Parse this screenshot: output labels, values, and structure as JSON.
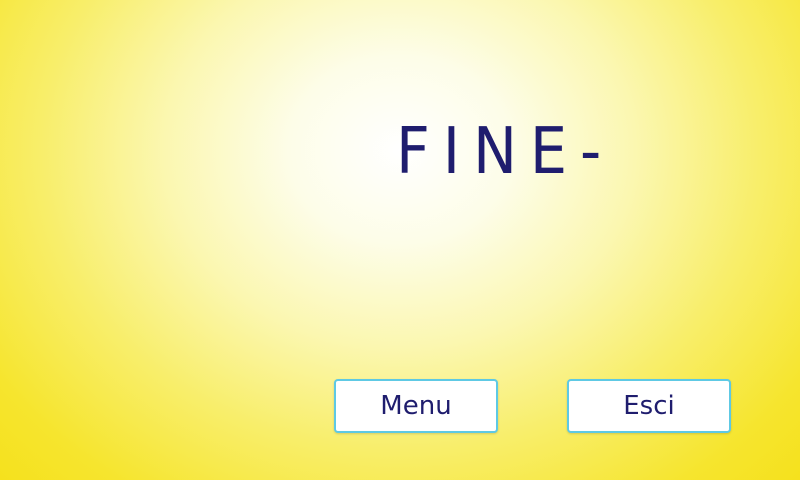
{
  "screen": {
    "headline": "FINE-"
  },
  "buttons": {
    "menu_label": "Menu",
    "exit_label": "Esci"
  },
  "colors": {
    "background_center": "#ffffff",
    "background_edge": "#f4de10",
    "text": "#1f1d6e",
    "button_border": "#5ec9e4",
    "button_fill": "#ffffff"
  }
}
